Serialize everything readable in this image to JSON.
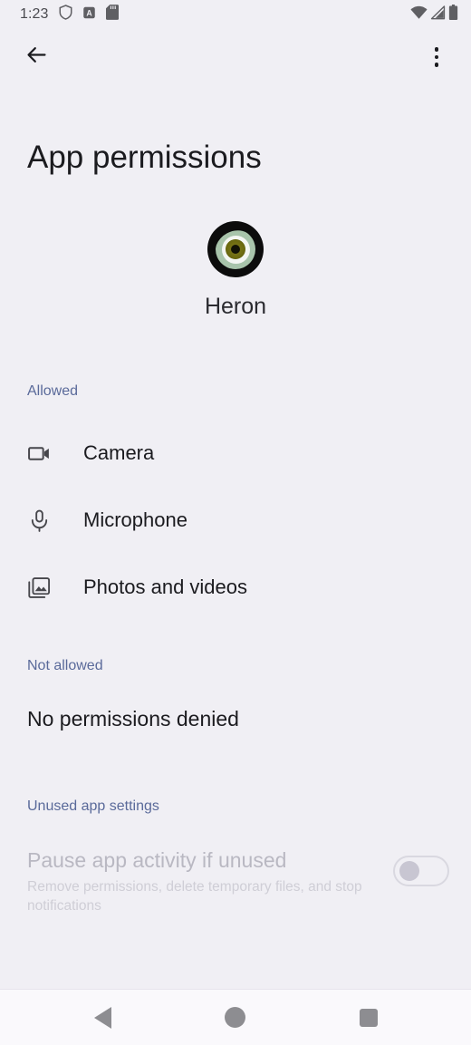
{
  "status_bar": {
    "time": "1:23",
    "left_icons": [
      "shield-icon",
      "a-box-icon",
      "sd-card-icon"
    ],
    "right_icons": [
      "wifi-icon",
      "cellular-signal-icon",
      "battery-icon"
    ]
  },
  "app_bar": {
    "back_label": "Back",
    "overflow_label": "More options"
  },
  "page": {
    "title": "App permissions",
    "app_name": "Heron",
    "app_icon": "eye-app-icon"
  },
  "sections": {
    "allowed": {
      "header": "Allowed",
      "items": [
        {
          "label": "Camera",
          "icon": "videocam-icon"
        },
        {
          "label": "Microphone",
          "icon": "microphone-icon"
        },
        {
          "label": "Photos and videos",
          "icon": "photo-library-icon"
        }
      ]
    },
    "not_allowed": {
      "header": "Not allowed",
      "empty_text": "No permissions denied"
    },
    "unused": {
      "header": "Unused app settings",
      "title": "Pause app activity if unused",
      "subtitle": "Remove permissions, delete temporary files, and stop notifications",
      "toggle_state": "off",
      "toggle_enabled": "false"
    }
  },
  "nav_bar": {
    "back": "Back",
    "home": "Home",
    "recents": "Recent apps"
  },
  "colors": {
    "background": "#f0eff4",
    "accent": "#5a6a9a",
    "text_primary": "#1b1b1f",
    "text_disabled": "#b9b8c2",
    "nav_icon": "#8d8d91"
  }
}
